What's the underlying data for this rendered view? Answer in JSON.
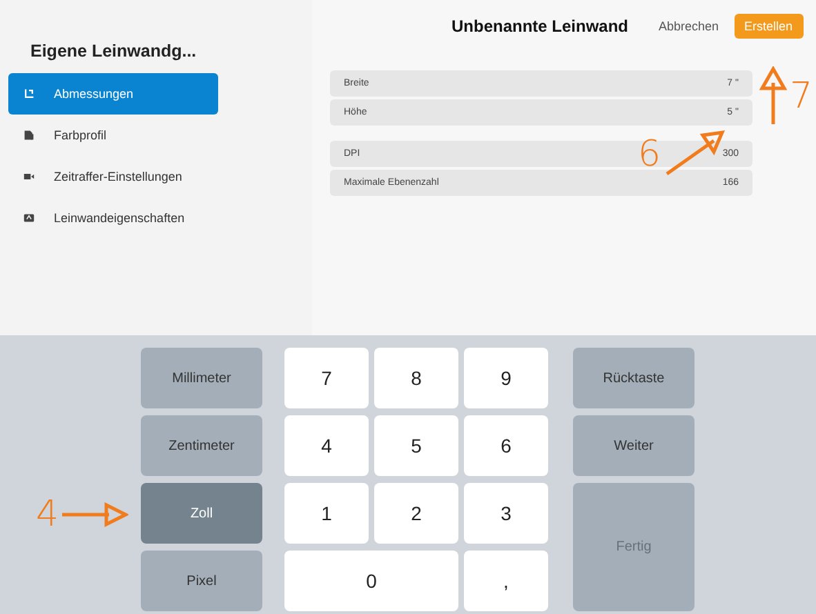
{
  "sidebar": {
    "title": "Eigene Leinwandg...",
    "items": [
      {
        "label": "Abmessungen",
        "kind": "dimensions",
        "selected": true
      },
      {
        "label": "Farbprofil",
        "kind": "document",
        "selected": false
      },
      {
        "label": "Zeitraffer-Einstellungen",
        "kind": "video",
        "selected": false
      },
      {
        "label": "Leinwandeigenschaften",
        "kind": "canvas",
        "selected": false
      }
    ]
  },
  "header": {
    "title": "Unbenannte Leinwand",
    "cancel": "Abbrechen",
    "create": "Erstellen"
  },
  "groups": [
    [
      {
        "label": "Breite",
        "value": "7 \""
      },
      {
        "label": "Höhe",
        "value": "5 \""
      }
    ],
    [
      {
        "label": "DPI",
        "value": "300"
      },
      {
        "label": "Maximale Ebenenzahl",
        "value": "166"
      }
    ]
  ],
  "keyboard": {
    "units": [
      {
        "label": "Millimeter",
        "selected": false
      },
      {
        "label": "Zentimeter",
        "selected": false
      },
      {
        "label": "Zoll",
        "selected": true
      },
      {
        "label": "Pixel",
        "selected": false
      }
    ],
    "digits": [
      {
        "label": "7",
        "kind": "normal"
      },
      {
        "label": "8",
        "kind": "normal"
      },
      {
        "label": "9",
        "kind": "normal"
      },
      {
        "label": "4",
        "kind": "normal"
      },
      {
        "label": "5",
        "kind": "normal"
      },
      {
        "label": "6",
        "kind": "normal"
      },
      {
        "label": "1",
        "kind": "normal"
      },
      {
        "label": "2",
        "kind": "normal"
      },
      {
        "label": "3",
        "kind": "normal"
      },
      {
        "label": "0",
        "kind": "wide"
      },
      {
        "label": ",",
        "kind": "normal"
      }
    ],
    "actions": [
      {
        "label": "Rücktaste",
        "kind": "normal",
        "disabled": false
      },
      {
        "label": "Weiter",
        "kind": "normal",
        "disabled": false
      },
      {
        "label": "Fertig",
        "kind": "tall",
        "disabled": true
      }
    ]
  },
  "annotations": [
    {
      "label": "6",
      "kind": "diagonal"
    },
    {
      "label": "7",
      "kind": "vertical"
    },
    {
      "label": "4",
      "kind": "horizontal"
    }
  ]
}
